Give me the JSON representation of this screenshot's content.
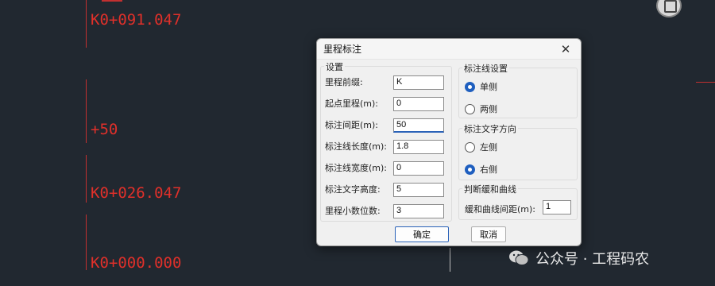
{
  "canvas": {
    "labels": [
      {
        "id": "top",
        "text": "K0+091.047"
      },
      {
        "id": "plus50",
        "text": "+50"
      },
      {
        "id": "mid",
        "text": "K0+026.047"
      },
      {
        "id": "start",
        "text": "K0+000.000"
      }
    ]
  },
  "dialog": {
    "title": "里程标注",
    "settings": {
      "title": "设置",
      "fields": [
        {
          "label": "里程前缀:",
          "value": "K"
        },
        {
          "label": "起点里程(m):",
          "value": "0"
        },
        {
          "label": "标注间距(m):",
          "value": "50"
        },
        {
          "label": "标注线长度(m):",
          "value": "1.8"
        },
        {
          "label": "标注线宽度(m):",
          "value": "0"
        },
        {
          "label": "标注文字高度:",
          "value": "5"
        },
        {
          "label": "里程小数位数:",
          "value": "3"
        }
      ]
    },
    "line_setting": {
      "title": "标注线设置",
      "options": [
        "单侧",
        "两侧"
      ],
      "selected": "单侧"
    },
    "text_direction": {
      "title": "标注文字方向",
      "options": [
        "左侧",
        "右侧"
      ],
      "selected": "右侧"
    },
    "curve": {
      "title": "判断缓和曲线",
      "label": "缓和曲线间距(m):",
      "value": "1"
    },
    "ok_label": "确定",
    "cancel_label": "取消"
  },
  "watermark": {
    "text": "公众号 · 工程码农"
  },
  "colors": {
    "background": "#212830",
    "cad_red": "#e0302a",
    "accent": "#1f5fbf"
  }
}
